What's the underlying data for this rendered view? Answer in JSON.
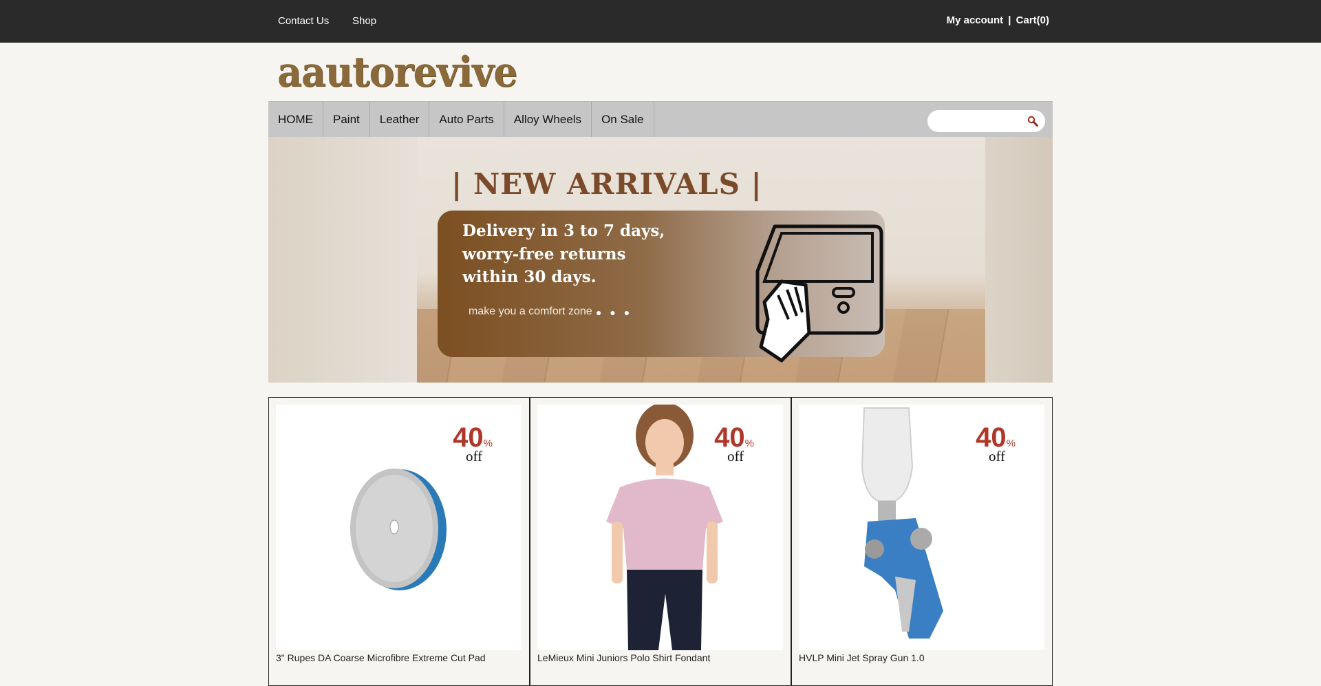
{
  "topbar": {
    "contact": "Contact Us",
    "shop": "Shop",
    "my_account": "My account",
    "separator": "|",
    "cart": "Cart(0)"
  },
  "logo": "aautorevive",
  "nav": {
    "items": [
      "HOME",
      "Paint",
      "Leather",
      "Auto Parts",
      "Alloy Wheels",
      "On Sale"
    ],
    "search_placeholder": ""
  },
  "banner": {
    "title": "| NEW ARRIVALS |",
    "line1": "Delivery in 3 to 7 days,",
    "line2": "worry-free returns",
    "line3": "within 30 days.",
    "tagline": "make you a comfort zone",
    "dots": "● ● ●"
  },
  "products": [
    {
      "name": "3\" Rupes DA Coarse Microfibre Extreme Cut Pad",
      "discount": "40",
      "pct": "%",
      "off": "off",
      "image": "grey-microfibre-pad"
    },
    {
      "name": "LeMieux Mini Juniors Polo Shirt Fondant",
      "discount": "40",
      "pct": "%",
      "off": "off",
      "image": "child-in-pink-polo"
    },
    {
      "name": "HVLP Mini Jet Spray Gun 1.0",
      "discount": "40",
      "pct": "%",
      "off": "off",
      "image": "blue-spray-gun"
    }
  ],
  "colors": {
    "topbar": "#2a2a2a",
    "nav": "#c6c6c6",
    "discount": "#b0362a",
    "logo": "#8a6a3a"
  }
}
